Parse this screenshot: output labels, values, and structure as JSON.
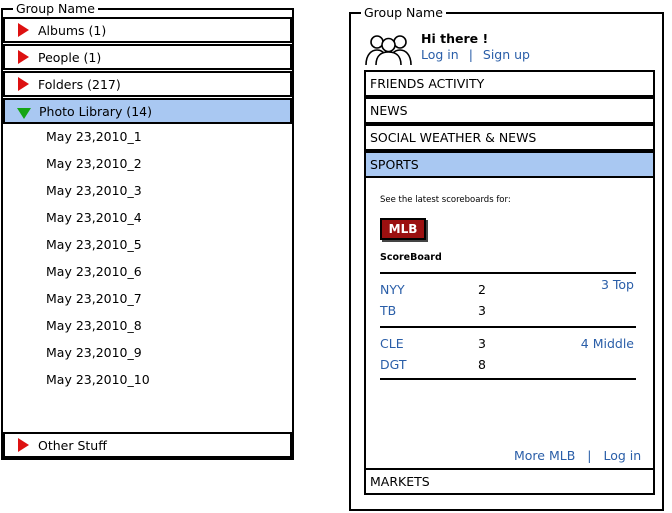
{
  "left_panel": {
    "legend": "Group Name",
    "groups": [
      {
        "label": "Albums (1)"
      },
      {
        "label": "People (1)"
      },
      {
        "label": "Folders (217)"
      },
      {
        "label": "Photo Library (14)"
      }
    ],
    "photo_items": [
      "May 23,2010_1",
      "May 23,2010_2",
      "May 23,2010_3",
      "May 23,2010_4",
      "May 23,2010_5",
      "May 23,2010_6",
      "May 23,2010_7",
      "May 23,2010_8",
      "May 23,2010_9",
      "May 23,2010_10"
    ],
    "other": {
      "label": "Other Stuff"
    },
    "colors": {
      "collapsed_arrow": "#dd1111",
      "expanded_arrow": "#15a515",
      "selected": "#a9c8f2"
    }
  },
  "right_panel": {
    "legend": "Group Name",
    "greeting": "Hi there !",
    "login": "Log in",
    "separator": "|",
    "signup": "Sign up",
    "nav": [
      {
        "label": "FRIENDS ACTIVITY"
      },
      {
        "label": "NEWS"
      },
      {
        "label": "SOCIAL WEATHER & NEWS"
      },
      {
        "label": "SPORTS"
      }
    ],
    "sports": {
      "intro": "See the latest scoreboards for:",
      "badge": "MLB",
      "scoreboard_title": "ScoreBoard",
      "games": [
        {
          "team1": "NYY",
          "score1": "2",
          "team2": "TB",
          "score2": "3",
          "status": "3 Top"
        },
        {
          "team1": "CLE",
          "score1": "3",
          "team2": "DGT",
          "score2": "8",
          "status": "4 Middle"
        }
      ],
      "more": "More MLB",
      "sep": "|",
      "login": "Log in"
    },
    "markets": {
      "label": "MARKETS"
    },
    "colors": {
      "link": "#2a5ea8",
      "badge_bg": "#9b1010"
    }
  }
}
